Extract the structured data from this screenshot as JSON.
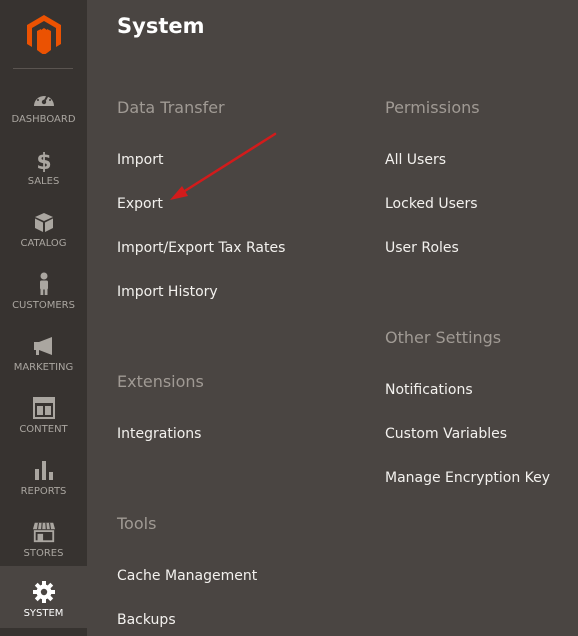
{
  "colors": {
    "sidebar_bg": "#373330",
    "panel_bg": "#4a4542",
    "brand_orange": "#eb5202",
    "arrow_red": "#d21b1b",
    "section_title": "#a09a94",
    "link": "#f3f1ee"
  },
  "sidebar": {
    "logo_icon": "magento-logo-icon",
    "items": [
      {
        "label": "DASHBOARD",
        "icon": "dashboard-icon"
      },
      {
        "label": "SALES",
        "icon": "dollar-icon"
      },
      {
        "label": "CATALOG",
        "icon": "box-icon"
      },
      {
        "label": "CUSTOMERS",
        "icon": "person-icon"
      },
      {
        "label": "MARKETING",
        "icon": "megaphone-icon"
      },
      {
        "label": "CONTENT",
        "icon": "layout-icon"
      },
      {
        "label": "REPORTS",
        "icon": "bar-chart-icon"
      },
      {
        "label": "STORES",
        "icon": "store-icon"
      },
      {
        "label": "SYSTEM",
        "icon": "gear-icon",
        "active": true
      }
    ]
  },
  "panel": {
    "title": "System",
    "sections": {
      "data_transfer": {
        "title": "Data Transfer",
        "links": [
          "Import",
          "Export",
          "Import/Export Tax Rates",
          "Import History"
        ]
      },
      "extensions": {
        "title": "Extensions",
        "links": [
          "Integrations"
        ]
      },
      "tools": {
        "title": "Tools",
        "links": [
          "Cache Management",
          "Backups"
        ]
      },
      "permissions": {
        "title": "Permissions",
        "links": [
          "All Users",
          "Locked Users",
          "User Roles"
        ]
      },
      "other_settings": {
        "title": "Other Settings",
        "links": [
          "Notifications",
          "Custom Variables",
          "Manage Encryption Key"
        ]
      }
    }
  }
}
